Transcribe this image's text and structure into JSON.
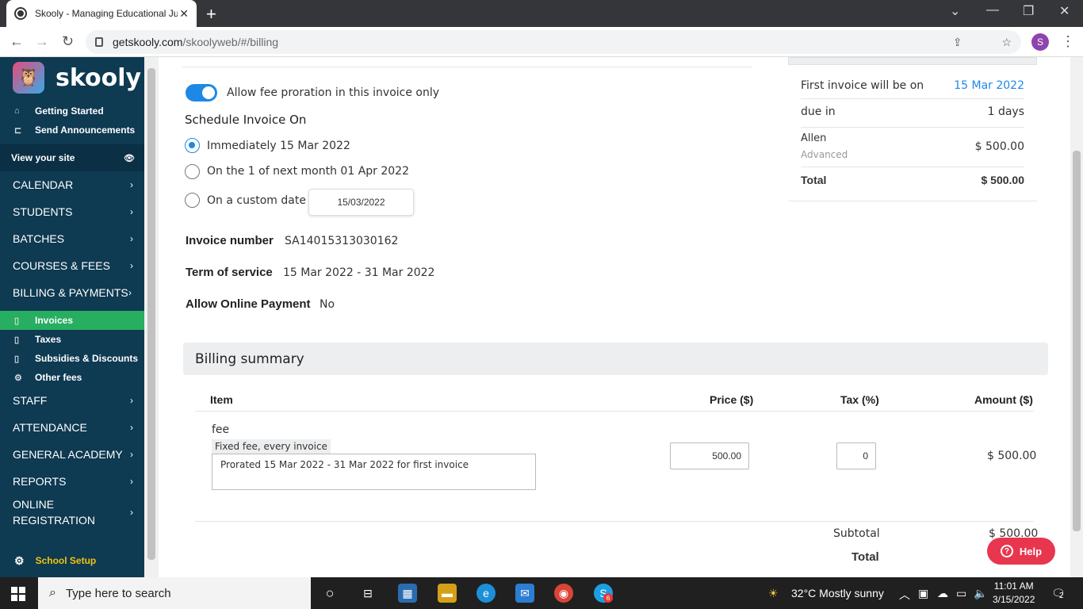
{
  "browser": {
    "tab_title": "Skooly - Managing Educational Ju",
    "url_host": "getskooly.com",
    "url_path": "/skoolyweb/#/billing",
    "profile_initial": "S"
  },
  "sidebar": {
    "brand": "skooly",
    "quick_links": [
      {
        "label": "Getting Started"
      },
      {
        "label": "Send Announcements"
      }
    ],
    "view_site": "View your site",
    "menu_top": [
      {
        "label": "CALENDAR"
      },
      {
        "label": "STUDENTS"
      },
      {
        "label": "BATCHES"
      },
      {
        "label": "COURSES & FEES"
      },
      {
        "label": "BILLING & PAYMENTS"
      }
    ],
    "billing_sub": [
      {
        "label": "Invoices",
        "active": true
      },
      {
        "label": "Taxes"
      },
      {
        "label": "Subsidies & Discounts"
      },
      {
        "label": "Other fees"
      }
    ],
    "menu_bottom": [
      {
        "label": "STAFF"
      },
      {
        "label": "ATTENDANCE"
      },
      {
        "label": "GENERAL ACADEMY"
      },
      {
        "label": "REPORTS"
      },
      {
        "label": "ONLINE REGISTRATION"
      }
    ],
    "school_setup": "School Setup"
  },
  "form": {
    "proration_label": "Allow fee proration in this invoice only",
    "proration_enabled": true,
    "schedule_heading": "Schedule Invoice On",
    "schedule_options": [
      {
        "label": "Immediately 15 Mar 2022",
        "selected": true
      },
      {
        "label": "On the 1 of next month 01 Apr 2022",
        "selected": false
      },
      {
        "label": "On a custom date",
        "selected": false
      }
    ],
    "custom_date_value": "15/03/2022",
    "invoice_number_label": "Invoice number",
    "invoice_number": "SA14015313030162",
    "term_label": "Term of service",
    "term_value": "15 Mar 2022 - 31 Mar 2022",
    "online_payment_label": "Allow Online Payment",
    "online_payment_value": "No"
  },
  "summary_card": {
    "first_invoice_label": "First invoice will be on",
    "first_invoice_date": "15 Mar 2022",
    "due_label": "due in",
    "due_value": "1 days",
    "student_name": "Allen",
    "student_level": "Advanced",
    "student_amount": "$ 500.00",
    "total_label": "Total",
    "total_value": "$ 500.00"
  },
  "billing_summary": {
    "heading": "Billing summary",
    "columns": {
      "item": "Item",
      "price": "Price ($)",
      "tax": "Tax (%)",
      "amount": "Amount ($)"
    },
    "rows": [
      {
        "name": "fee",
        "tag": "Fixed fee, every invoice",
        "note": "Prorated 15 Mar 2022 - 31 Mar 2022 for first invoice",
        "price": "500.00",
        "tax": "0",
        "amount": "$ 500.00"
      }
    ],
    "subtotal_label": "Subtotal",
    "subtotal_value": "$ 500.00",
    "total_label": "Total"
  },
  "help_button": "Help",
  "taskbar": {
    "search_placeholder": "Type here to search",
    "weather": "32°C  Mostly sunny",
    "time": "11:01 AM",
    "date": "3/15/2022",
    "notification_count": "2",
    "skype_badge": "6"
  },
  "colors": {
    "sidebar_bg": "#0e3a52",
    "active_green": "#27ae60",
    "accent_blue": "#1e88e5",
    "help_red": "#e8364f"
  }
}
